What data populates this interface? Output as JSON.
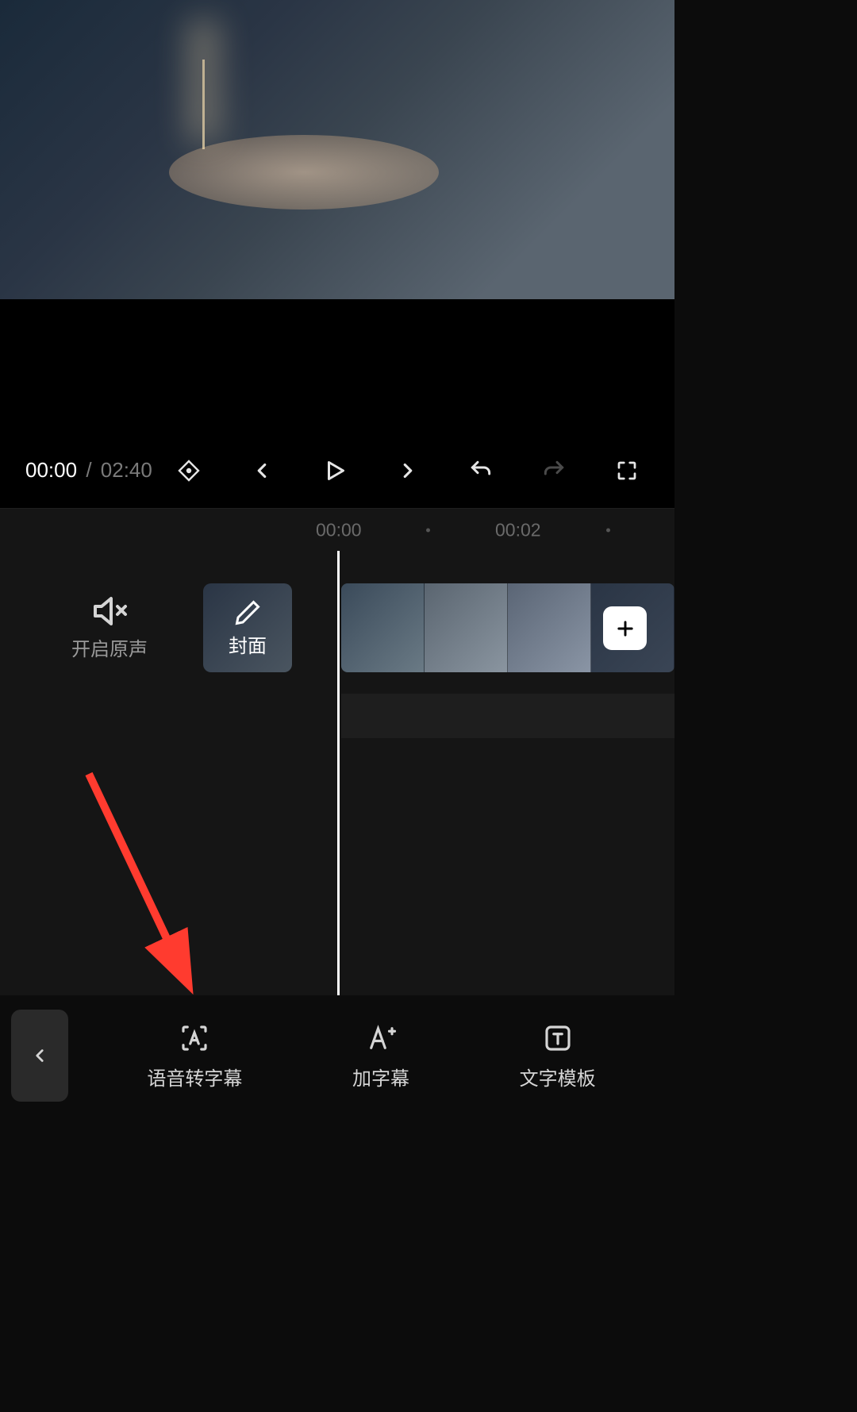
{
  "playback": {
    "current_time": "00:00",
    "separator": "/",
    "total_time": "02:40"
  },
  "timeline": {
    "ticks": [
      "00:00",
      "00:02"
    ],
    "mute_label": "开启原声",
    "cover_label": "封面"
  },
  "bottom_actions": [
    {
      "label": "语音转字幕"
    },
    {
      "label": "加字幕"
    },
    {
      "label": "文字模板"
    }
  ],
  "annotation": {
    "arrow_color": "#ff3b2f"
  }
}
